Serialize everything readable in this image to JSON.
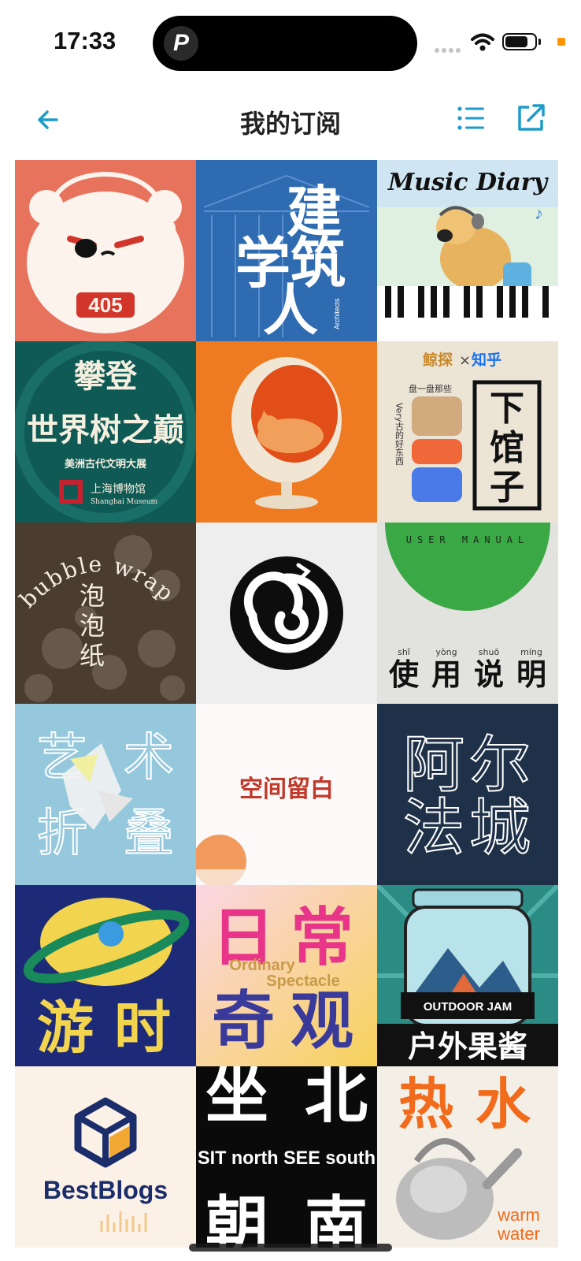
{
  "status_bar": {
    "time": "17:33",
    "island_logo": "P"
  },
  "nav": {
    "title": "我的订阅",
    "back_icon": "arrow-left-icon",
    "list_icon": "list-icon",
    "share_icon": "external-link-icon",
    "accent": "#1e9bc8"
  },
  "tiles": [
    {
      "badge": "405"
    },
    {
      "line1": "建",
      "line2": "学筑",
      "line3": "人",
      "small": "Architects"
    },
    {
      "title": "Music Diary"
    },
    {
      "line1": "攀登",
      "line2": "世界树之巅",
      "sub": "美洲古代文明大展",
      "museum_cn": "上海博物馆",
      "museum_en": "Shanghai Museum"
    },
    {},
    {
      "brand1": "鲸探",
      "cross": "×",
      "brand2": "知乎",
      "tag": "盘一盘那些",
      "vertical": "Very古的好东西",
      "big1": "下",
      "big2": "馆",
      "big3": "子"
    },
    {
      "arc": "bubble wrap",
      "v1": "泡",
      "v2": "泡",
      "v3": "纸"
    },
    {},
    {
      "top": "USER MANUAL",
      "py1": "shǐ",
      "py2": "yòng",
      "py3": "shuō",
      "py4": "míng",
      "c1": "使",
      "c2": "用",
      "c3": "说",
      "c4": "明"
    },
    {
      "c1": "艺",
      "c2": "术",
      "c3": "折",
      "c4": "叠"
    },
    {
      "text": "空间留白"
    },
    {
      "c1": "阿",
      "c2": "尔",
      "c3": "法",
      "c4": "城"
    },
    {
      "c1": "游",
      "c2": "时"
    },
    {
      "c1": "日",
      "c2": "常",
      "c3": "奇",
      "c4": "观",
      "en1": "Ordinary",
      "en2": "Spectacle"
    },
    {
      "label": "OUTDOOR JAM",
      "cn": "户外果酱"
    },
    {
      "name": "BestBlogs"
    },
    {
      "c1": "坐",
      "c2": "北",
      "en": "SIT north SEE south",
      "c3": "朝",
      "c4": "南"
    },
    {
      "c1": "热",
      "c2": "水",
      "en1": "warm",
      "en2": "water"
    }
  ]
}
